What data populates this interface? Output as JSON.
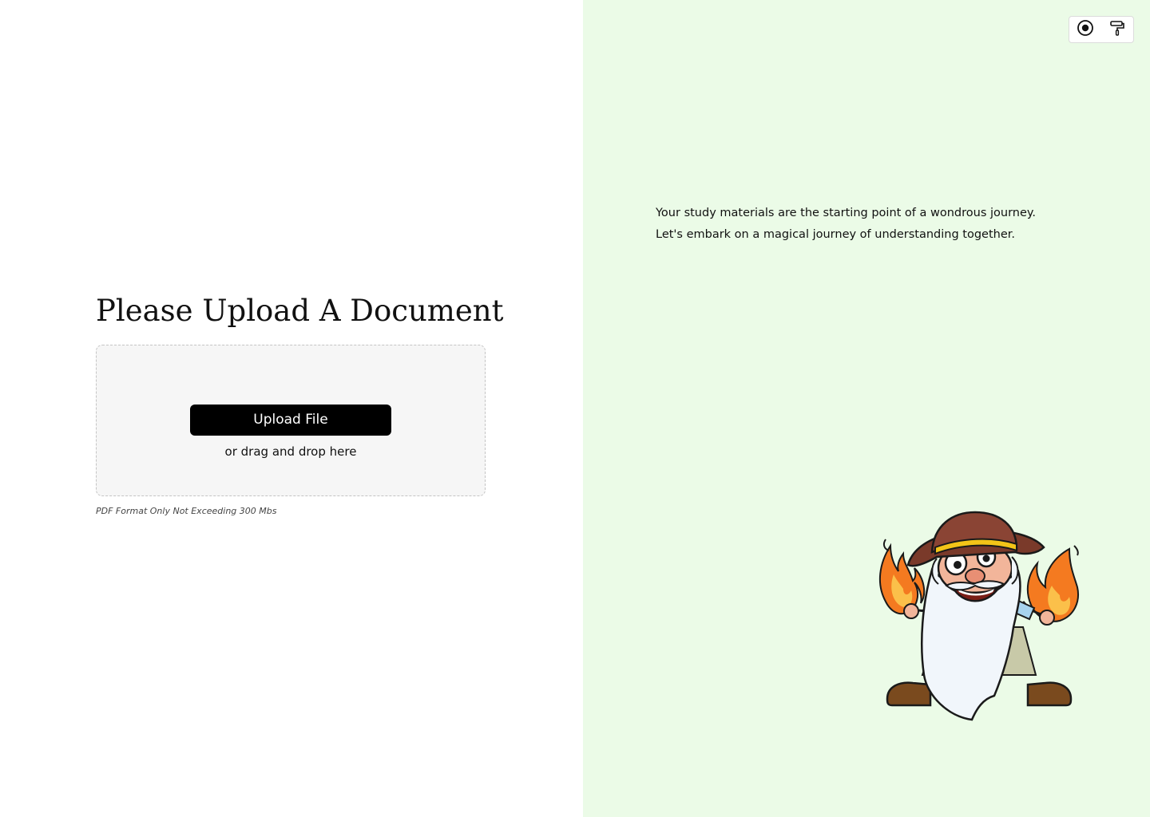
{
  "upload": {
    "title": "Please Upload A Document",
    "button_label": "Upload File",
    "drag_hint": "or drag and drop here",
    "format_note": "PDF Format Only Not Exceeding 300 Mbs"
  },
  "toolbar": {
    "icons": [
      "record-icon",
      "paint-roller-icon"
    ]
  },
  "intro": {
    "line1": "Your study materials are the starting point of a wondrous journey.",
    "line2": "Let's embark on a magical journey of understanding together."
  },
  "colors": {
    "right_panel_bg": "#ebfbe7",
    "button_bg": "#000000",
    "dropzone_bg": "#f6f6f6"
  }
}
